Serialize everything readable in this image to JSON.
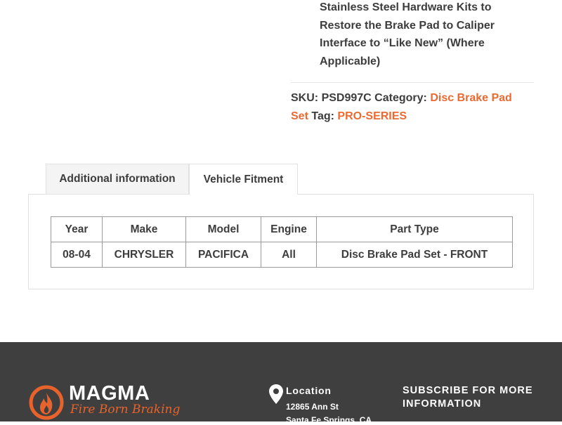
{
  "product": {
    "feature_text": "Stainless Steel Hardware Kits to Restore the Brake Pad to Caliper Interface to “Like New” (Where Applicable)",
    "sku_label": "SKU:",
    "sku_value": "PSD997C",
    "category_label": "Category:",
    "category_value": "Disc Brake Pad Set",
    "tag_label": "Tag:",
    "tag_value": "PRO-SERIES"
  },
  "tabs": [
    {
      "label": "Additional information",
      "active": false
    },
    {
      "label": "Vehicle Fitment",
      "active": true
    }
  ],
  "fitment": {
    "headers": [
      "Year",
      "Make",
      "Model",
      "Engine",
      "Part Type"
    ],
    "rows": [
      [
        "08-04",
        "CHRYSLER",
        "PACIFICA",
        "All",
        "Disc Brake Pad Set - FRONT"
      ]
    ]
  },
  "footer": {
    "logo_word": "MAGMA",
    "logo_tagline": "Fire Born Braking",
    "location_title": "Location",
    "address_line1": "12865 Ann St",
    "address_line2": "Santa Fe Springs, CA",
    "subscribe_heading": "SUBSCRIBE FOR MORE INFORMATION"
  },
  "colors": {
    "accent": "#ec6a31",
    "footer_bg": "#3f3f3f",
    "text": "#3d3d3d"
  },
  "icons": [
    "magma-flame-logo-icon",
    "location-pin-icon"
  ]
}
